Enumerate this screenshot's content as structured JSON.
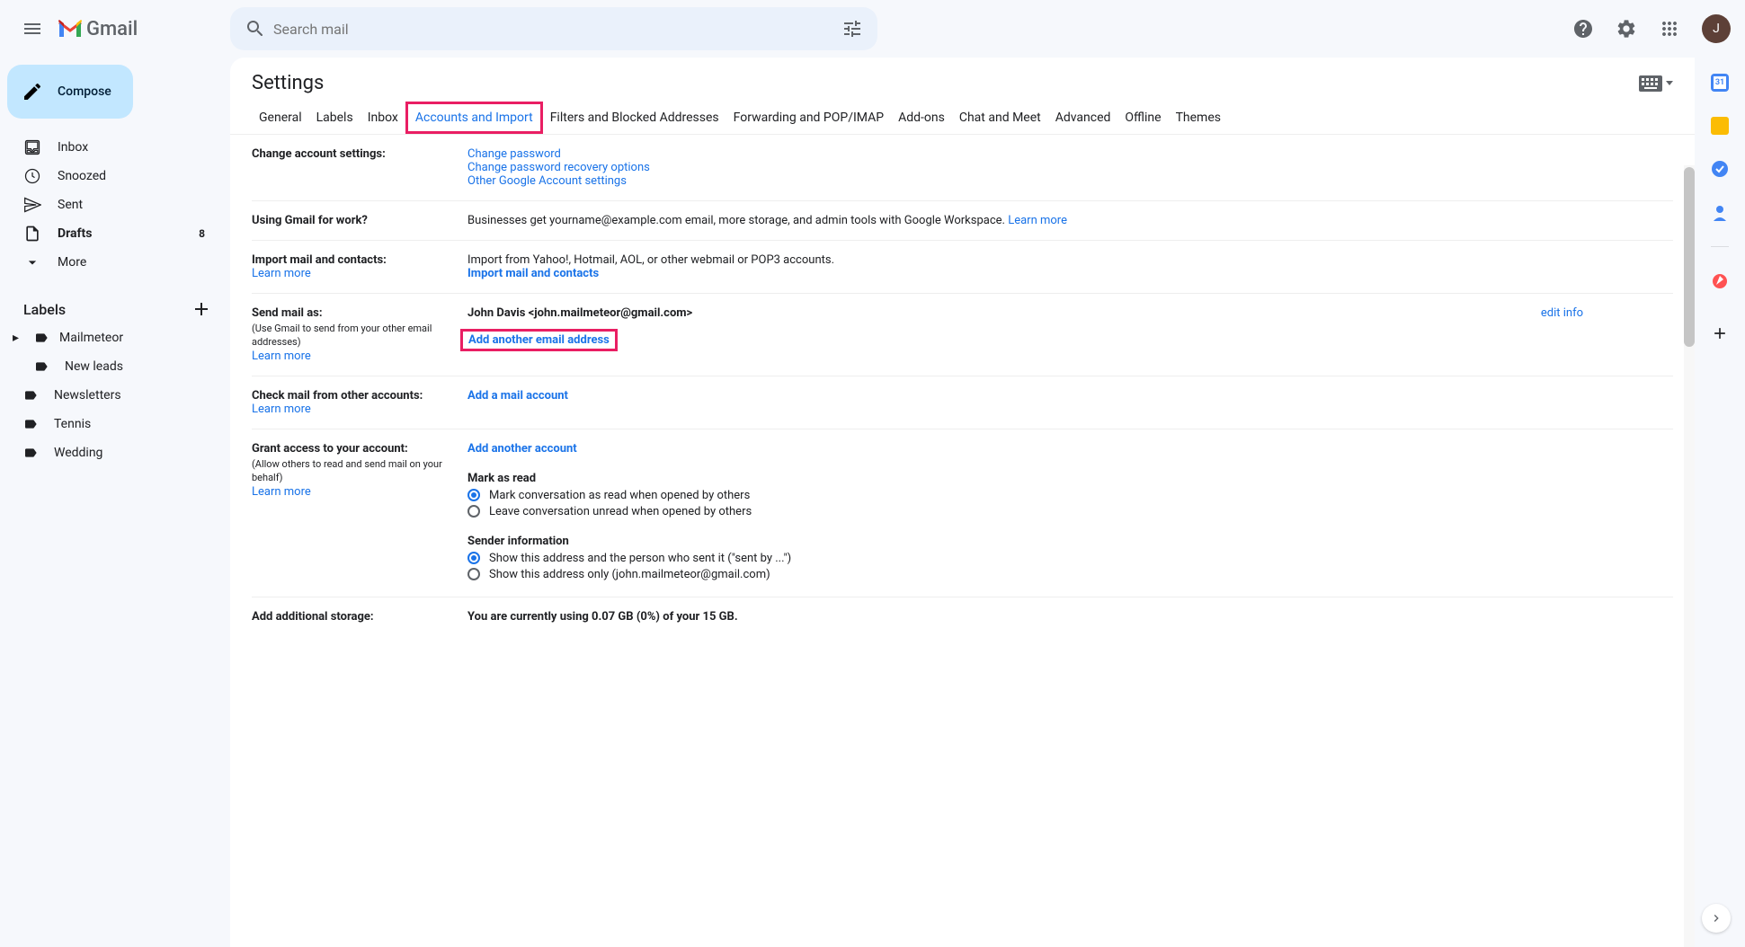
{
  "header": {
    "product_name": "Gmail",
    "search_placeholder": "Search mail",
    "avatar_initial": "J"
  },
  "sidebar": {
    "compose": "Compose",
    "nav": [
      {
        "label": "Inbox",
        "bold": false
      },
      {
        "label": "Snoozed",
        "bold": false
      },
      {
        "label": "Sent",
        "bold": false
      },
      {
        "label": "Drafts",
        "bold": true,
        "count": "8"
      },
      {
        "label": "More",
        "bold": false
      }
    ],
    "labels_header": "Labels",
    "labels": [
      {
        "label": "Mailmeteor",
        "expandable": true
      },
      {
        "label": "New leads",
        "sub": true
      },
      {
        "label": "Newsletters"
      },
      {
        "label": "Tennis"
      },
      {
        "label": "Wedding"
      }
    ]
  },
  "settings": {
    "title": "Settings",
    "tabs": [
      "General",
      "Labels",
      "Inbox",
      "Accounts and Import",
      "Filters and Blocked Addresses",
      "Forwarding and POP/IMAP",
      "Add-ons",
      "Chat and Meet",
      "Advanced",
      "Offline",
      "Themes"
    ],
    "active_tab_index": 3,
    "rows": {
      "change_account": {
        "title": "Change account settings:",
        "links": [
          "Change password",
          "Change password recovery options",
          "Other Google Account settings"
        ]
      },
      "work": {
        "title": "Using Gmail for work?",
        "text": "Businesses get yourname@example.com email, more storage, and admin tools with Google Workspace. ",
        "learn_more": "Learn more"
      },
      "import": {
        "title": "Import mail and contacts:",
        "learn_more": "Learn more",
        "text": "Import from Yahoo!, Hotmail, AOL, or other webmail or POP3 accounts.",
        "action": "Import mail and contacts"
      },
      "send_as": {
        "title": "Send mail as:",
        "sub": "(Use Gmail to send from your other email addresses)",
        "learn_more": "Learn more",
        "identity": "John Davis <john.mailmeteor@gmail.com>",
        "edit": "edit info",
        "add": "Add another email address"
      },
      "check_mail": {
        "title": "Check mail from other accounts:",
        "learn_more": "Learn more",
        "action": "Add a mail account"
      },
      "grant": {
        "title": "Grant access to your account:",
        "sub": "(Allow others to read and send mail on your behalf)",
        "learn_more": "Learn more",
        "action": "Add another account",
        "mark_as_read_title": "Mark as read",
        "mark_opt1": "Mark conversation as read when opened by others",
        "mark_opt2": "Leave conversation unread when opened by others",
        "sender_title": "Sender information",
        "sender_opt1": "Show this address and the person who sent it (\"sent by ...\")",
        "sender_opt2": "Show this address only (john.mailmeteor@gmail.com)"
      },
      "storage": {
        "title": "Add additional storage:",
        "text": "You are currently using 0.07 GB (0%) of your 15 GB."
      }
    }
  }
}
